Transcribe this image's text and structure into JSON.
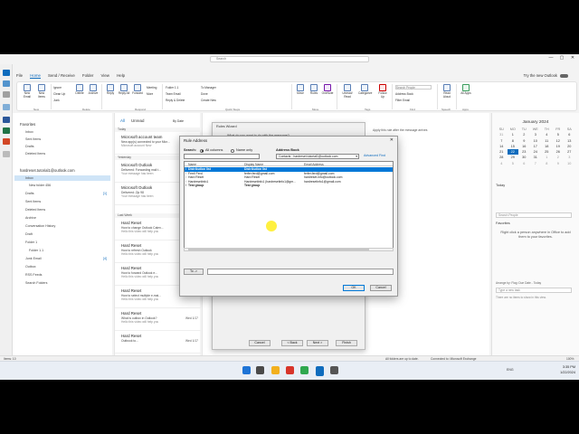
{
  "window": {
    "search_placeholder": "Search",
    "controls": [
      "—",
      "▢",
      "✕"
    ]
  },
  "menu": {
    "tabs": [
      "File",
      "Home",
      "Send / Receive",
      "Folder",
      "View",
      "Help"
    ],
    "try_new": "Try the new Outlook"
  },
  "ribbon": {
    "new_email": "New Email",
    "new_items": "New Items",
    "ignore": "Ignore",
    "clean_up": "Clean Up",
    "junk": "Junk",
    "delete": "Delete",
    "archive": "Archive",
    "reply": "Reply",
    "reply_all": "Reply All",
    "forward": "Forward",
    "meeting": "Meeting",
    "more": "More",
    "folder_item": "Folder 1.1",
    "team_email": "Team Email",
    "reply_delete": "Reply & Delete",
    "to_manager": "To Manager",
    "done": "Done",
    "create_new": "Create New",
    "move": "Move",
    "rules": "Rules",
    "onenote": "OneNote",
    "unread_read": "Unread/ Read",
    "categorize": "Categorize",
    "follow_up": "Follow Up",
    "search_people": "Search People",
    "address_book": "Address Book",
    "filter_email": "Filter Email",
    "read_aloud": "Read Aloud",
    "all_apps": "All Apps",
    "groups": [
      "New",
      "Delete",
      "Respond",
      "Quick Steps",
      "Move",
      "Tags",
      "Find",
      "Speech",
      "Apps"
    ]
  },
  "folders": {
    "favorites": "Favorites",
    "fav_items": [
      "Inbox",
      "Sent Items",
      "Drafts",
      "Deleted Items"
    ],
    "account": "hardreset.tutorial1@outlook.com",
    "items": [
      {
        "label": "Inbox",
        "count": ""
      },
      {
        "label": "New folder 456",
        "count": ""
      },
      {
        "label": "Drafts",
        "count": "[1]"
      },
      {
        "label": "Sent Items",
        "count": ""
      },
      {
        "label": "Deleted Items",
        "count": ""
      },
      {
        "label": "Archive",
        "count": ""
      },
      {
        "label": "Conversation History",
        "count": ""
      },
      {
        "label": "Draft",
        "count": ""
      },
      {
        "label": "Folder 1",
        "count": ""
      },
      {
        "label": "Folder 1.1",
        "count": ""
      },
      {
        "label": "Junk Email",
        "count": "[4]"
      },
      {
        "label": "Outbox",
        "count": ""
      },
      {
        "label": "RSS Feeds",
        "count": ""
      },
      {
        "label": "Search Folders",
        "count": ""
      }
    ]
  },
  "messages": {
    "tab_all": "All",
    "tab_unread": "Unread",
    "sort": "By Date",
    "groups": [
      "Today",
      "Yesterday",
      "Last Week"
    ],
    "items": [
      {
        "from": "Microsoft account team",
        "subject": "New app(s) connected to your Micr...",
        "preview": "Microsoft account New",
        "date": ""
      },
      {
        "from": "Microsoft Outlook",
        "subject": "Delivered: Forwarding mail t...",
        "preview": "Your message has been",
        "date": ""
      },
      {
        "from": "Microsoft Outlook",
        "subject": "Delivered: Zip 98",
        "preview": "Your message has been",
        "date": ""
      },
      {
        "from": "Hard Reset",
        "subject": "How to change Outlook Calen...",
        "preview": "Hello this video will help you",
        "date": "Wed 1/17"
      },
      {
        "from": "Hard Reset",
        "subject": "How to refresh Outlook",
        "preview": "Hello this video will help you",
        "date": "Wed 1/17"
      },
      {
        "from": "Hard Reset",
        "subject": "How to forward Outlook e...",
        "preview": "Hello this video will help you",
        "date": "Wed 1/17"
      },
      {
        "from": "Hard Reset",
        "subject": "How to select multiple e-mai...",
        "preview": "Hello this video will help you",
        "date": "Wed 1/17"
      },
      {
        "from": "Hard Reset",
        "subject": "What is outbox in Outlook?",
        "preview": "Hello this video will help you",
        "date": "Wed 1/17"
      },
      {
        "from": "Hard Reset",
        "subject": "Outbook to...",
        "preview": "",
        "date": "Wed 1/17"
      }
    ]
  },
  "calendar": {
    "month": "January 2024",
    "weekdays": [
      "SU",
      "MO",
      "TU",
      "WE",
      "TH",
      "FR",
      "SA"
    ],
    "weeks": [
      [
        "31",
        "1",
        "2",
        "3",
        "4",
        "5",
        "6"
      ],
      [
        "7",
        "8",
        "9",
        "10",
        "11",
        "12",
        "13"
      ],
      [
        "14",
        "15",
        "16",
        "17",
        "18",
        "19",
        "20"
      ],
      [
        "21",
        "22",
        "23",
        "24",
        "25",
        "26",
        "27"
      ],
      [
        "28",
        "29",
        "30",
        "31",
        "1",
        "2",
        "3"
      ],
      [
        "4",
        "5",
        "6",
        "7",
        "8",
        "9",
        "10"
      ]
    ],
    "today": "22",
    "today_label": "Today",
    "search_people": "Search People",
    "favorites_label": "Favorites",
    "favorites_note": "Right click a person anywhere in Office to add them to your favorites.",
    "arrange": "Arrange by: Flag: Due Date - Today",
    "type_task": "Type a new task",
    "no_items": "There are no items to show in this view."
  },
  "wizard": {
    "title": "Rules Wizard",
    "question": "What do you want to do with the message?",
    "step2": "Step 2: Edit the rule description (click an underlined value)",
    "rule_text": "Apply this rule after the message arrives",
    "cancel": "Cancel",
    "back": "< Back",
    "next": "Next >",
    "finish": "Finish"
  },
  "dialog": {
    "title": "Rule Address",
    "close": "✕",
    "search_label": "Search:",
    "all_columns": "All columns",
    "name_only": "Name only",
    "address_book_label": "Address Book",
    "address_book_value": "Contacts - hardreset.tutorial1@outlook.com",
    "advanced_find": "Advanced Find",
    "col_name": "Name",
    "col_display": "Display Name",
    "col_email": "Email Address",
    "rows": [
      {
        "name": "Distribution list",
        "display": "Distribution list",
        "email": "",
        "selected": true,
        "bold": true
      },
      {
        "name": "Ferril Ferd",
        "display": "ferfer.ferd@gmail.com",
        "email": "ferfer.ferd@gmail.com",
        "selected": false,
        "bold": false
      },
      {
        "name": "Hard Reset",
        "display": "Hard Reset",
        "email": "hardreset.info@outlook.com",
        "selected": false,
        "bold": false
      },
      {
        "name": "Hardresetinfo1",
        "display": "Hardresetinfo1 (hardresetinfo1@gm...",
        "email": "hardresetinfo1@gmail.com",
        "selected": false,
        "bold": false
      },
      {
        "name": "Test group",
        "display": "Test group",
        "email": "",
        "selected": false,
        "bold": true
      }
    ],
    "to_button": "To ->",
    "ok": "OK",
    "cancel": "Cancel"
  },
  "status": {
    "items": "Items: 10",
    "all_folders": "All folders are up to date.",
    "connected": "Connected to: Microsoft Exchange",
    "zoom": "100%"
  },
  "taskbar": {
    "lang": "ENG",
    "time": "3:35 PM",
    "date": "1/22/2024"
  },
  "colors": {
    "accent": "#0f6cbd",
    "selection": "#0078d7"
  }
}
